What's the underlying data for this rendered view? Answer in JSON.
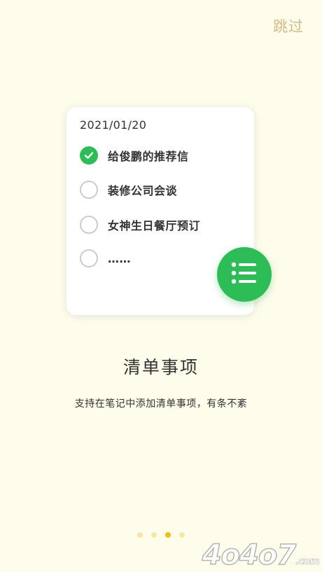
{
  "header": {
    "skip_label": "跳过"
  },
  "card": {
    "date": "2021/01/20",
    "items": [
      {
        "label": "给俊鹏的推荐信",
        "checked": true
      },
      {
        "label": "装修公司会谈",
        "checked": false
      },
      {
        "label": "女神生日餐厅预订",
        "checked": false
      },
      {
        "label": "……",
        "checked": false
      }
    ]
  },
  "fab": {
    "icon": "list-icon"
  },
  "intro": {
    "title": "清单事项",
    "subtitle": "支持在笔记中添加清单事项，有条不紊"
  },
  "pager": {
    "count": 4,
    "active_index": 2
  },
  "watermark": {
    "text": "4o4o7",
    "domain": ".com"
  },
  "colors": {
    "background": "#FEFCEB",
    "accent_green": "#2DBD57",
    "skip_text": "#D2BC86",
    "dot_active": "#F3BE10",
    "dot_inactive": "#F7E7A6"
  }
}
